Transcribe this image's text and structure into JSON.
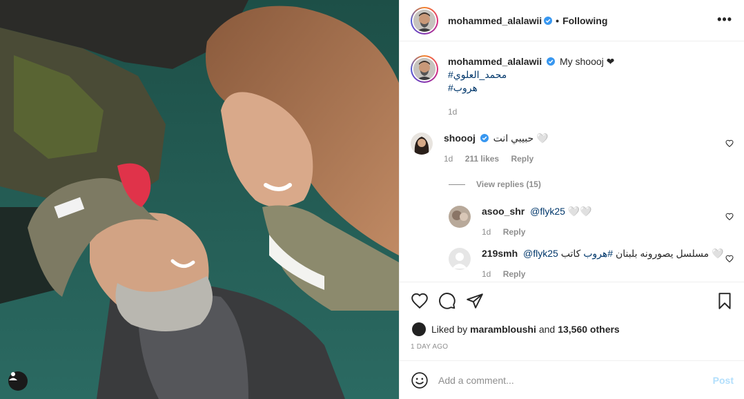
{
  "post": {
    "username": "mohammed_alalawii",
    "follow_state": "Following",
    "separator": "•",
    "more_label": "•••"
  },
  "caption": {
    "username": "mohammed_alalawii",
    "text": "My shoooj ❤",
    "hashtag1": "#محمد_العلوي",
    "hashtag2": "#هروب",
    "time": "1d"
  },
  "comments": [
    {
      "username": "shoooj",
      "text": "حبيبي انت 🤍",
      "time": "1d",
      "likes": "211 likes",
      "reply": "Reply"
    },
    {
      "username": "asoo_shr",
      "mention": "@flyk25",
      "text": "🤍🤍",
      "time": "1d",
      "reply": "Reply"
    },
    {
      "username": "219smh",
      "mention": "@flyk25",
      "text_hashtag": "#هروب",
      "text_before": "كاتب",
      "text_after": "مسلسل يصورونه بلبنان",
      "emoji": "🤍",
      "time": "1d",
      "reply": "Reply"
    }
  ],
  "view_replies": "View replies (15)",
  "likes": {
    "prefix": "Liked by",
    "user": "marambloushi",
    "middle": "and",
    "others": "13,560 others"
  },
  "date": "1 DAY AGO",
  "add_comment": {
    "placeholder": "Add a comment...",
    "post_label": "Post"
  },
  "colors": {
    "link": "#00376b",
    "verified": "#3897f0",
    "muted": "#8e8e8e",
    "post_disabled": "#b2dffc"
  }
}
